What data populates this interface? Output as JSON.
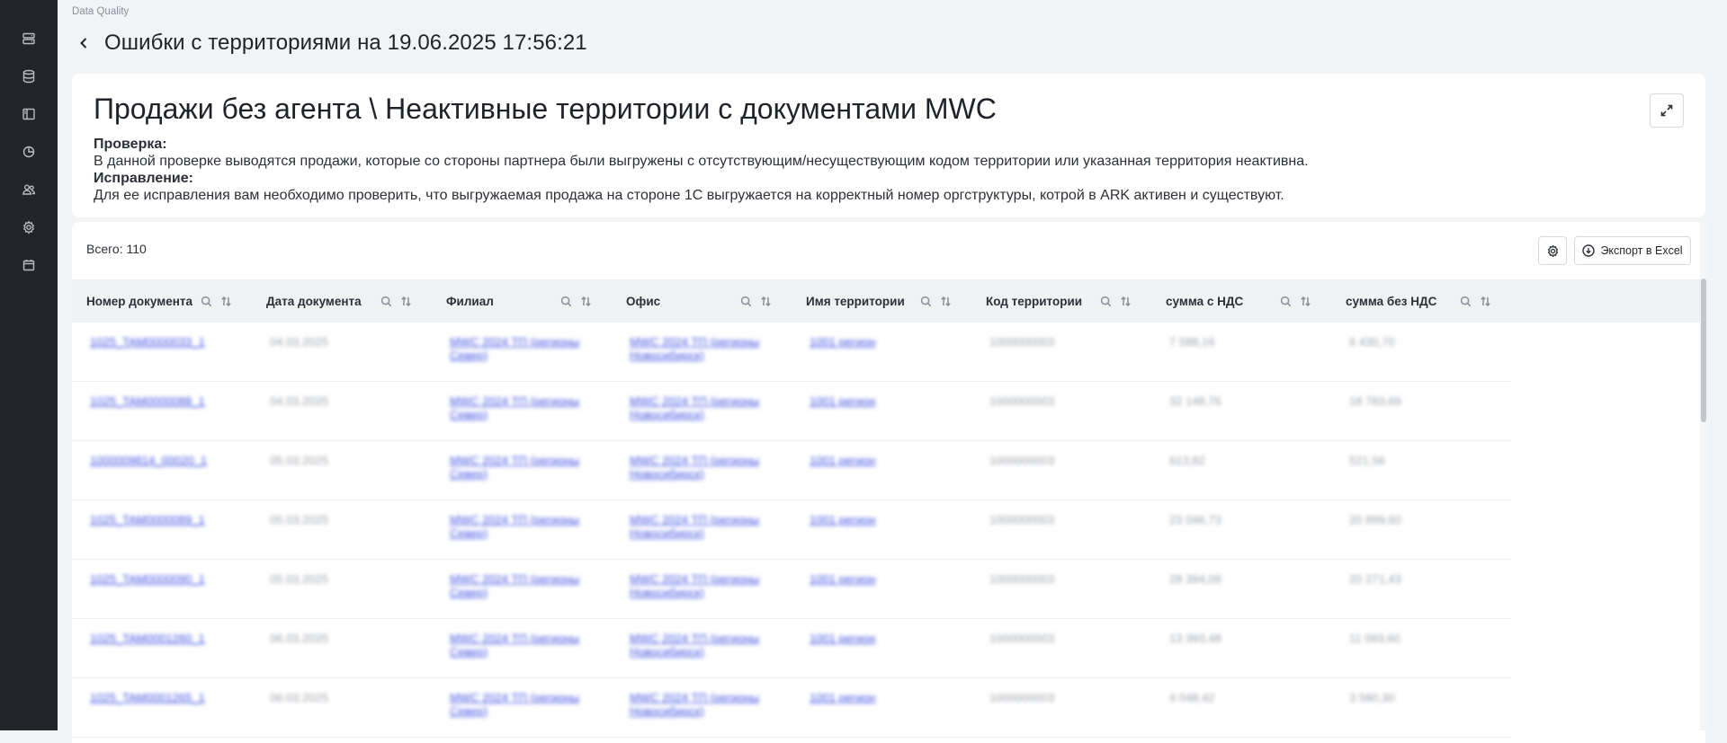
{
  "breadcrumb": "Data Quality",
  "page_title": "Ошибки с территориями на 19.06.2025 17:56:21",
  "sidebar_icons": [
    "server-icon",
    "database-icon",
    "layout-icon",
    "pie-chart-icon",
    "users-icon",
    "settings-icon",
    "calendar-icon"
  ],
  "check": {
    "title": "Продажи без агента \\ Неактивные территории с документами MWC",
    "check_label": "Проверка:",
    "check_text": "В данной проверке выводятся продажи, которые со стороны партнера были выгружены с отсутствующим/несуществующим кодом территории или указанная территория неактивна.",
    "fix_label": "Исправление:",
    "fix_text": "Для ее исправления вам необходимо проверить, что выгружаемая продажа на стороне 1С выгружается на корректный номер оргструктуры, котрой в ARK активен и существуют."
  },
  "table": {
    "total": "Всего: 110",
    "export_label": "Экспорт в Excel",
    "columns": [
      "Номер документа",
      "Дата документа",
      "Филиал",
      "Офис",
      "Имя территории",
      "Код территории",
      "сумма с НДС",
      "сумма без НДС"
    ],
    "rows": [
      [
        "1025_TAM0000033_1",
        "04.03.2025",
        "MWC 2024 ТП (регионы Север)",
        "MWC 2024 ТП (регионы Новосибирск)",
        "1001 регион",
        "1000000003",
        "7 588,16",
        "6 430,70"
      ],
      [
        "1025_TAM0000088_1",
        "04.03.2025",
        "MWC 2024 ТП (регионы Север)",
        "MWC 2024 ТП (регионы Новосибирск)",
        "1001 регион",
        "1000000003",
        "32 148,76",
        "18 783,69"
      ],
      [
        "1000009814_00020_1",
        "05.03.2025",
        "MWC 2024 ТП (регионы Север)",
        "MWC 2024 ТП (регионы Новосибирск)",
        "1001 регион",
        "1000000003",
        "613,82",
        "521,56"
      ],
      [
        "1025_TAM0000089_1",
        "05.03.2025",
        "MWC 2024 ТП (регионы Север)",
        "MWC 2024 ТП (регионы Новосибирск)",
        "1001 регион",
        "1000000003",
        "23 046,73",
        "20 899,60"
      ],
      [
        "1025_TAM0000090_1",
        "05.03.2025",
        "MWC 2024 ТП (регионы Север)",
        "MWC 2024 ТП (регионы Новосибирск)",
        "1001 регион",
        "1000000003",
        "28 394,09",
        "20 271,43"
      ],
      [
        "1025_TAM0001260_1",
        "06.03.2025",
        "MWC 2024 ТП (регионы Север)",
        "MWC 2024 ТП (регионы Новосибирск)",
        "1001 регион",
        "1000000003",
        "13 393,48",
        "11 093,60"
      ],
      [
        "1025_TAM0001265_1",
        "06.03.2025",
        "MWC 2024 ТП (регионы Север)",
        "MWC 2024 ТП (регионы Новосибирск)",
        "1001 регион",
        "1000000003",
        "4 048,42",
        "3 580,30"
      ]
    ]
  }
}
